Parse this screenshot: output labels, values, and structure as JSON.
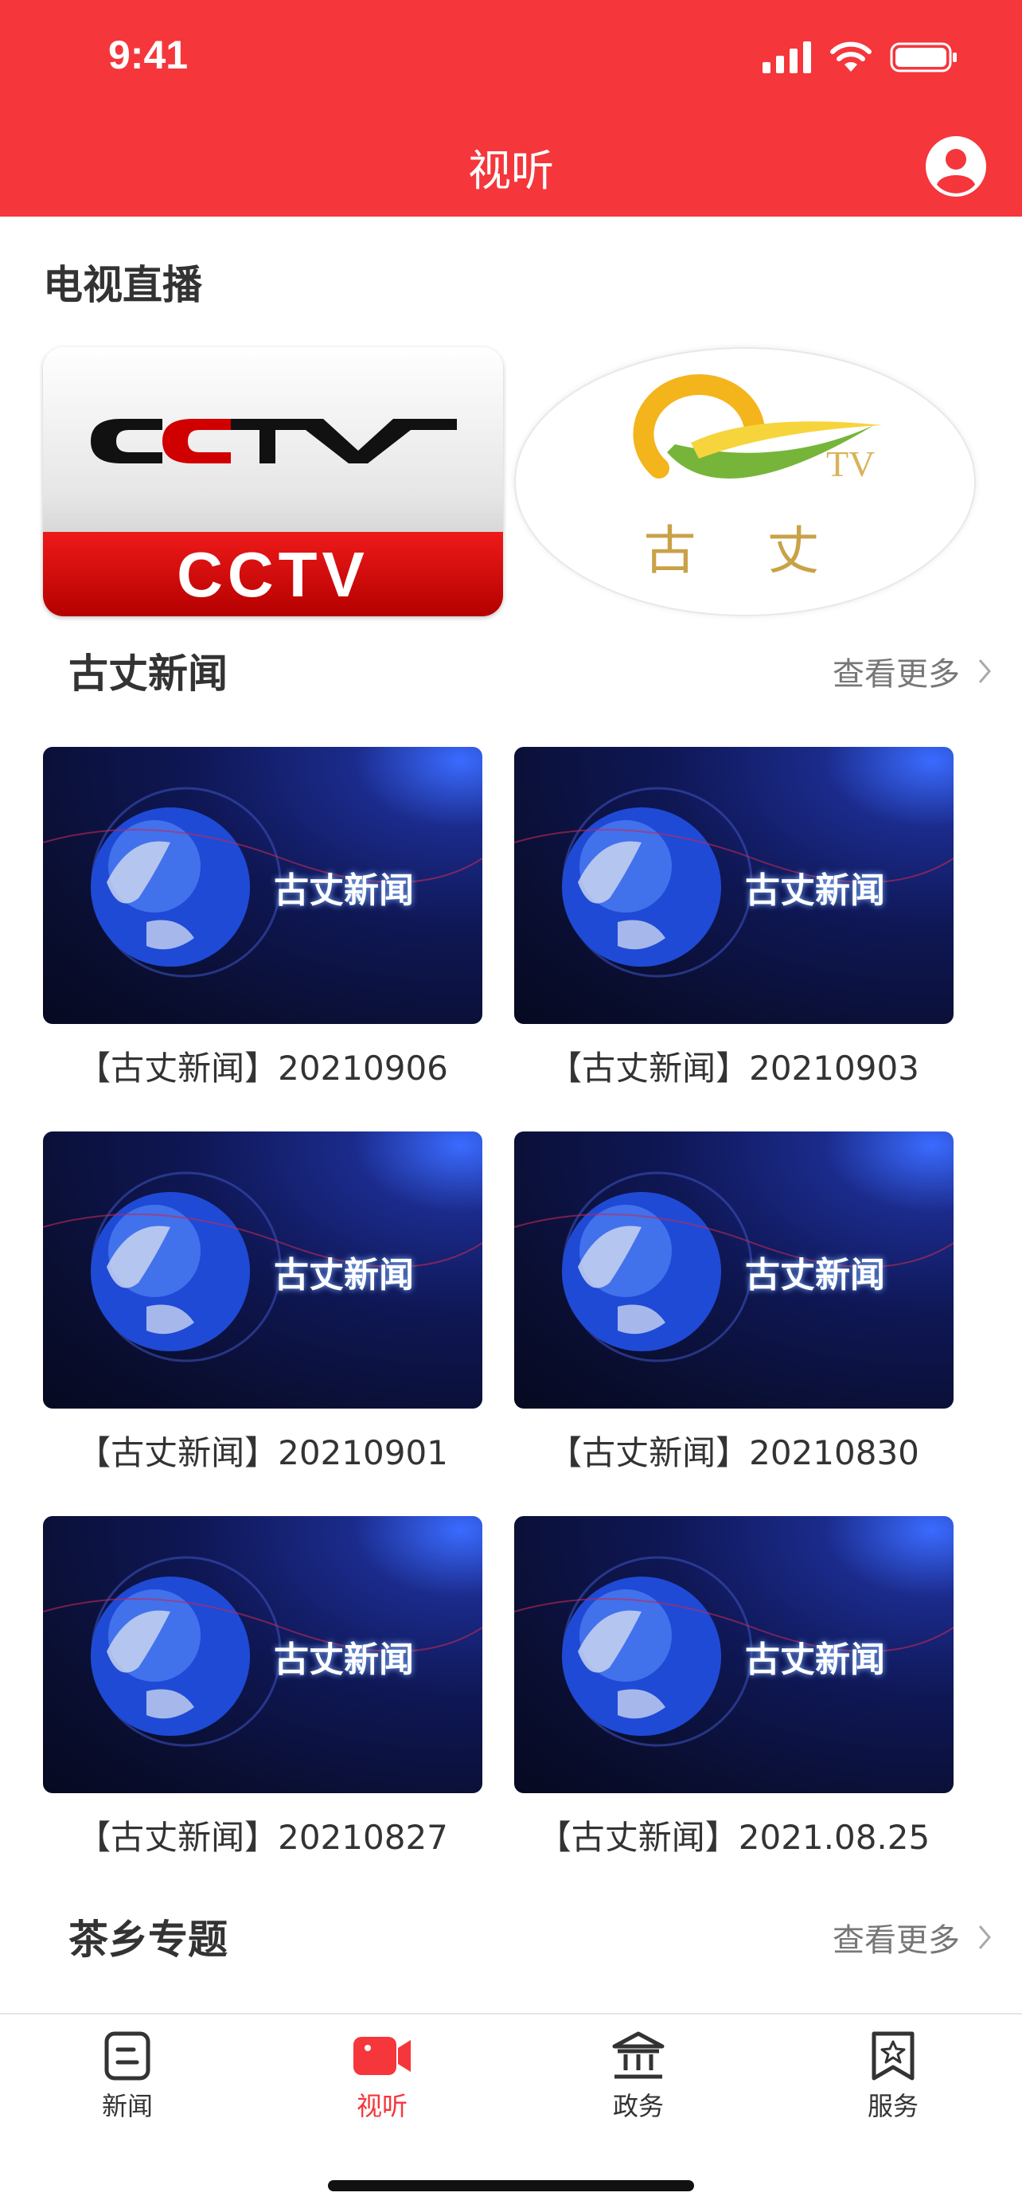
{
  "status_bar": {
    "time": "9:41"
  },
  "header": {
    "title": "视听"
  },
  "live": {
    "section_title": "电视直播",
    "channels": [
      {
        "logo_text": "CCTV",
        "label": "CCTV"
      },
      {
        "logo_text": "TV",
        "label": "古 丈"
      }
    ]
  },
  "news": {
    "section_title": "古丈新闻",
    "more_label": "查看更多",
    "thumb_caption": "古丈新闻",
    "items": [
      {
        "title": "【古丈新闻】20210906"
      },
      {
        "title": "【古丈新闻】20210903"
      },
      {
        "title": "【古丈新闻】20210901"
      },
      {
        "title": "【古丈新闻】20210830"
      },
      {
        "title": "【古丈新闻】20210827"
      },
      {
        "title": "【古丈新闻】2021.08.25"
      }
    ]
  },
  "tea": {
    "section_title": "茶乡专题",
    "more_label": "查看更多"
  },
  "tabbar": {
    "items": [
      {
        "label": "新闻",
        "icon": "news-icon",
        "active": false
      },
      {
        "label": "视听",
        "icon": "video-icon",
        "active": true
      },
      {
        "label": "政务",
        "icon": "government-icon",
        "active": false
      },
      {
        "label": "服务",
        "icon": "service-icon",
        "active": false
      }
    ]
  },
  "colors": {
    "brand": "#f5363b",
    "text": "#333333",
    "muted": "#777777"
  }
}
